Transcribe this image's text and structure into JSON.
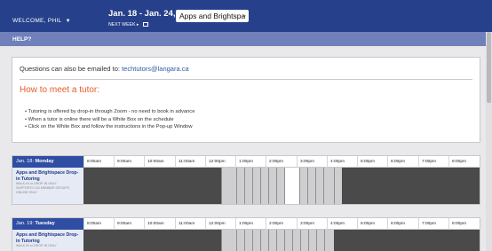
{
  "header": {
    "welcome": "WELCOME, PHIL",
    "date_range": "Jan. 18 - Jan. 24, 2021",
    "next_week": "NEXT WEEK ▸",
    "course_select": "Apps and Brightspa"
  },
  "help": {
    "label": "HELP?"
  },
  "info": {
    "email_prefix": "Questions can also be emailed to:",
    "email": "techtutors@langara.ca",
    "title": "How to meet a tutor:",
    "bullets": [
      "Tutoring is offered by drop-in through Zoom - no need to book in advance",
      "When a tutor is online there will be a White Box on the schedule",
      "Click on the White Box and follow the instructions in the Pop-up Window"
    ]
  },
  "schedule": {
    "times": [
      "8:00am",
      "9:00am",
      "10:00am",
      "11:00am",
      "12:00pm",
      "1:00pm",
      "2:00pm",
      "3:00pm",
      "4:00pm",
      "5:00pm",
      "6:00pm",
      "7:00pm",
      "8:00pm"
    ],
    "days": [
      {
        "date": "Jan. 18:",
        "weekday": "Monday",
        "row_title": "Apps and Brightspace Drop-in Tutoring",
        "row_sub": [
          "WALK-IN or DROP-IN ONLY",
          "SUPPORTS 100 MEMBER GROUPS",
          "ONLINE ONLY"
        ]
      },
      {
        "date": "Jan. 19:",
        "weekday": "Tuesday",
        "row_title": "Apps and Brightspace Drop-in Tutoring",
        "row_sub": [
          "WALK-IN or DROP-IN ONLY"
        ]
      }
    ]
  },
  "colors": {
    "topbar": "#27408b",
    "helpbar": "#6f80ba",
    "accent_orange": "#e65c2a",
    "available_slot": "#ffffff",
    "unavailable": "#4a4a4a"
  }
}
